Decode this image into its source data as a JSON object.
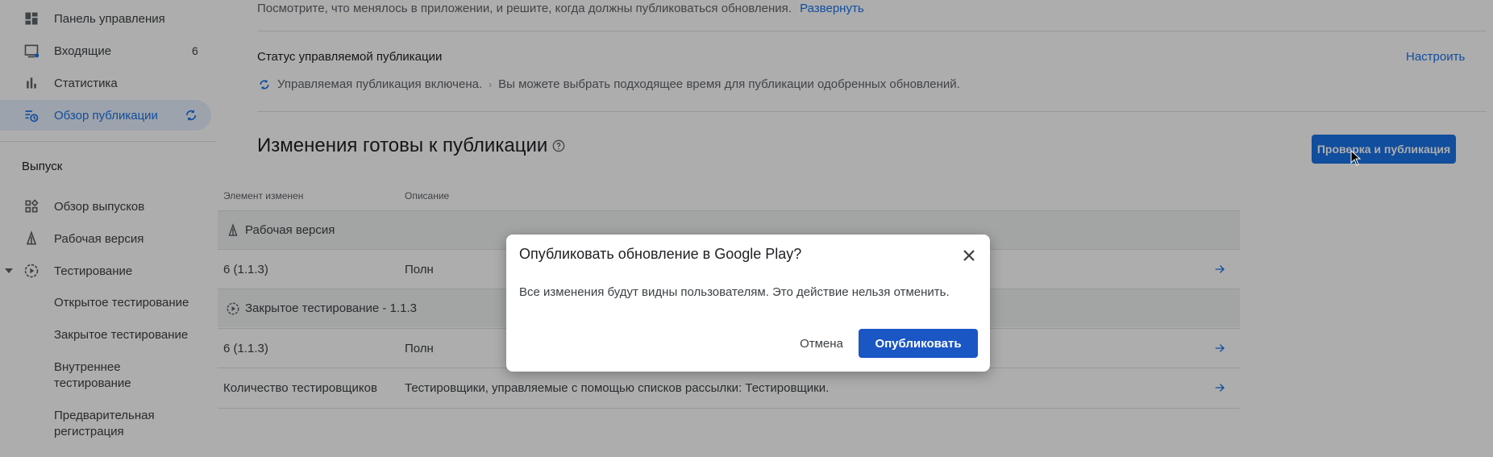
{
  "sidebar": {
    "items": [
      {
        "label": "Панель управления",
        "icon": "dashboard-icon"
      },
      {
        "label": "Входящие",
        "icon": "inbox-icon",
        "count": "6"
      },
      {
        "label": "Статистика",
        "icon": "stats-icon"
      },
      {
        "label": "Обзор публикации",
        "icon": "publishing-overview-icon",
        "active": true
      }
    ],
    "release_section": "Выпуск",
    "release_items": [
      {
        "label": "Обзор выпусков",
        "icon": "releases-overview-icon"
      },
      {
        "label": "Рабочая версия",
        "icon": "production-icon"
      },
      {
        "label": "Тестирование",
        "icon": "testing-icon"
      }
    ],
    "testing_sub": [
      "Открытое тестирование",
      "Закрытое тестирование",
      "Внутреннее тестирование",
      "Предварительная регистрация"
    ]
  },
  "main": {
    "intro_text": "Посмотрите, что менялось в приложении, и решите, когда должны публиковаться обновления.",
    "intro_link": "Развернуть",
    "status_title": "Статус управляемой публикации",
    "configure_link": "Настроить",
    "status_enabled": "Управляемая публикация включена.",
    "status_hint": "Вы можете выбрать подходящее время для публикации одобренных обновлений.",
    "changes_heading": "Изменения готовы к публикации",
    "review_button": "Проверка и публикация",
    "table": {
      "headers": [
        "Элемент изменен",
        "Описание"
      ],
      "group1": "Рабочая версия",
      "row1": {
        "item": "6 (1.1.3)",
        "desc": "Полн"
      },
      "group2": "Закрытое тестирование - 1.1.3",
      "row2": {
        "item": "6 (1.1.3)",
        "desc": "Полн"
      },
      "row3": {
        "item": "Количество тестировщиков",
        "desc": "Тестировщики, управляемые с помощью списков рассылки: Тестировщики."
      }
    }
  },
  "dialog": {
    "title": "Опубликовать обновление в Google Play?",
    "body": "Все изменения будут видны пользователям. Это действие нельзя отменить.",
    "cancel": "Отмена",
    "publish": "Опубликовать"
  },
  "colors": {
    "accent": "#1a73e8",
    "publish_button": "#1a56c4",
    "active_bg": "#e8f0fe"
  }
}
